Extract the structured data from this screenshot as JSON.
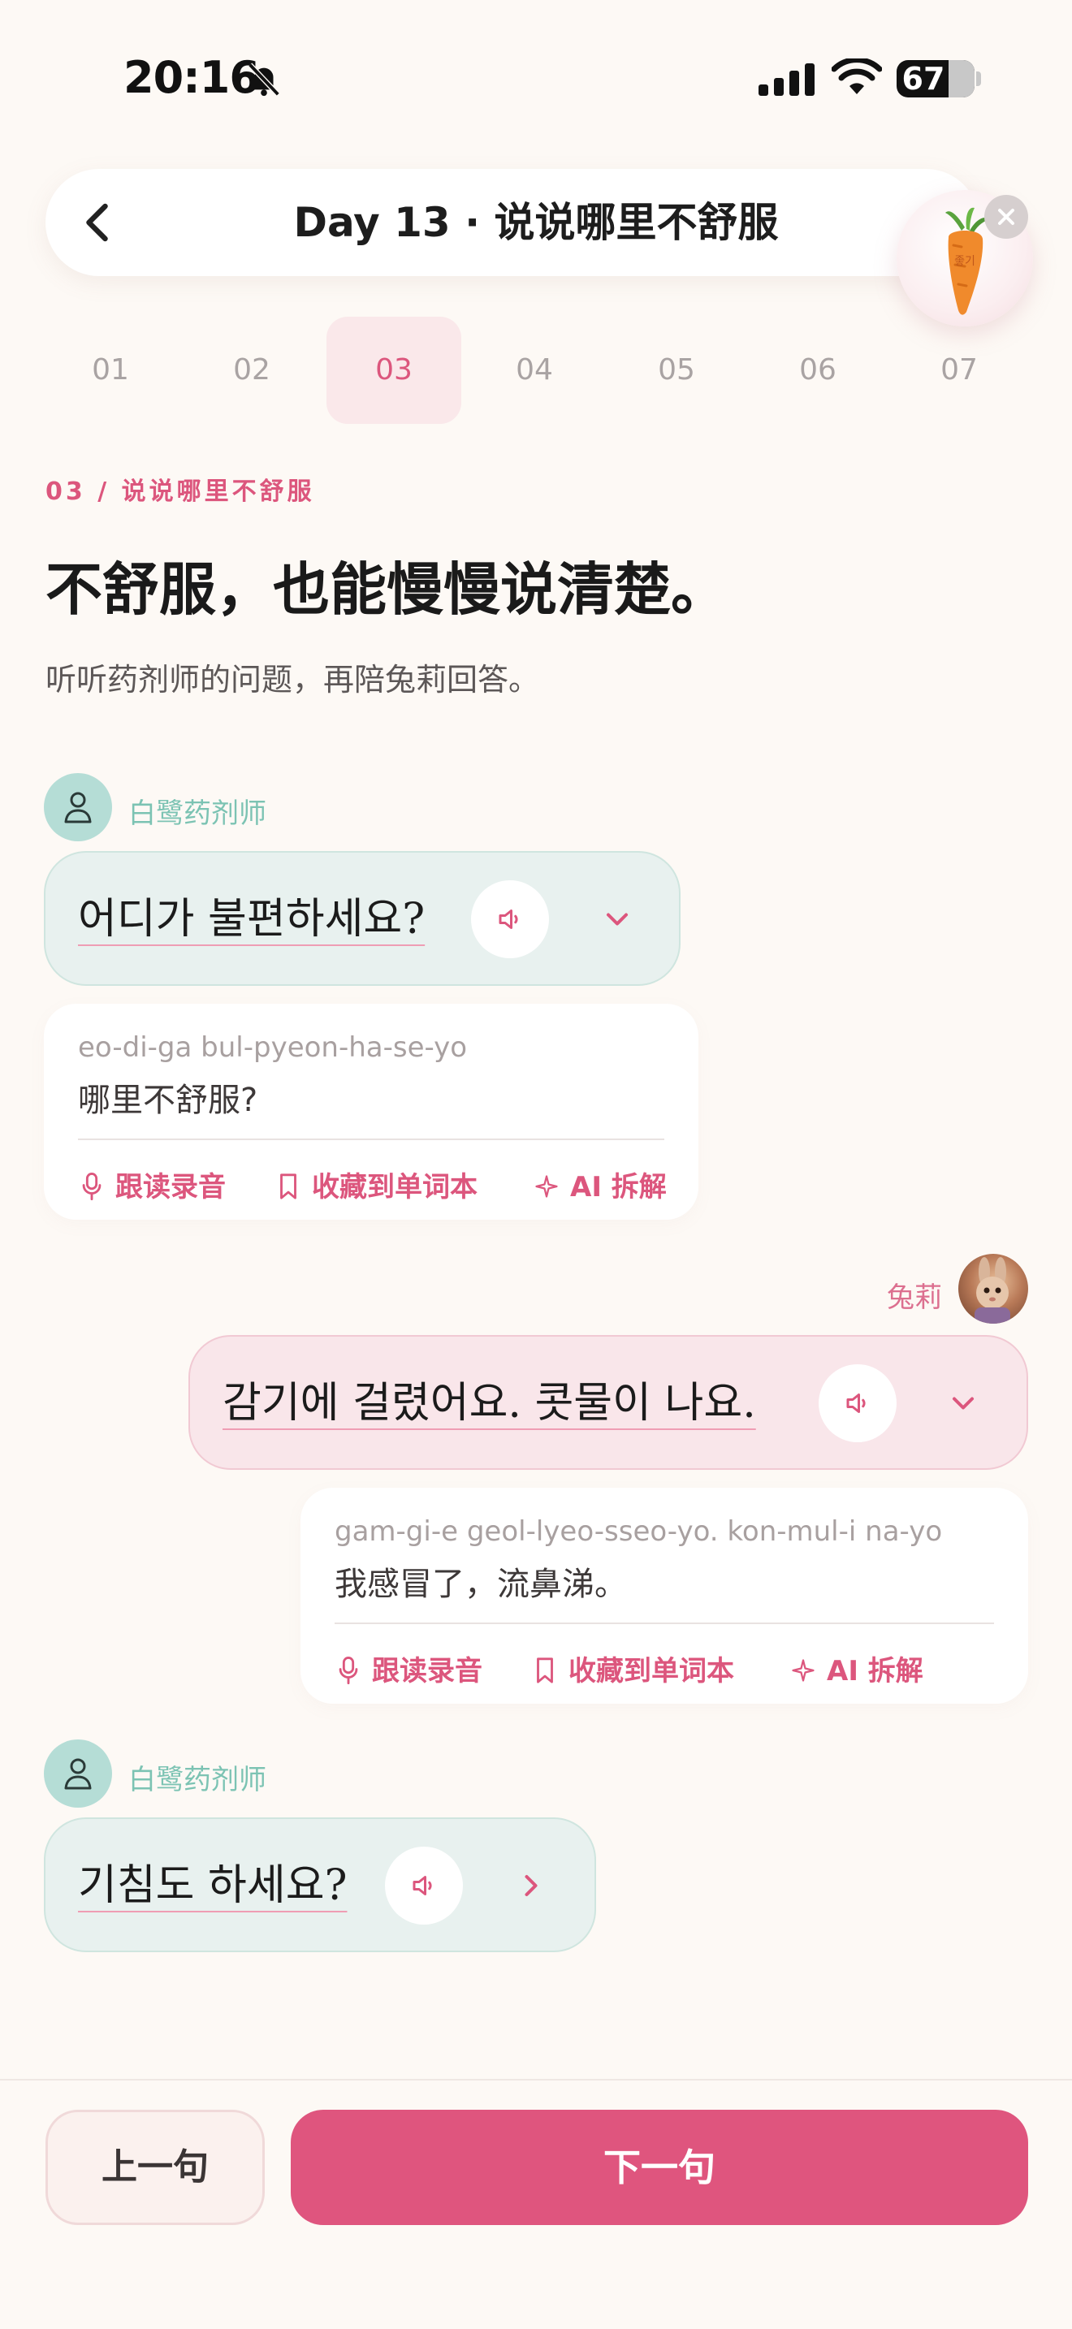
{
  "status_bar": {
    "time": "20:16",
    "battery": "67",
    "battery_level": 0.67
  },
  "header": {
    "title": "Day 13 · 说说哪里不舒服"
  },
  "tabs": [
    {
      "label": "01",
      "active": false
    },
    {
      "label": "02",
      "active": false
    },
    {
      "label": "03",
      "active": true
    },
    {
      "label": "04",
      "active": false
    },
    {
      "label": "05",
      "active": false
    },
    {
      "label": "06",
      "active": false
    },
    {
      "label": "07",
      "active": false
    }
  ],
  "lesson": {
    "crumb": "03 / 说说哪里不舒服",
    "title": "不舒服，也能慢慢说清楚。",
    "subtitle": "听听药剂师的问题，再陪兔莉回答。"
  },
  "actions": {
    "shadow": "跟读录音",
    "save": "收藏到单词本",
    "ai": "AI 拆解"
  },
  "dialogue": [
    {
      "speaker": "白鹭药剂师",
      "korean": "어디가 불편하세요?",
      "romanization": "eo-di-ga bul-pyeon-ha-se-yo",
      "translation": "哪里不舒服?"
    },
    {
      "speaker": "兔莉",
      "korean": "감기에 걸렸어요. 콧물이 나요.",
      "romanization": "gam-gi-e geol-lyeo-sseo-yo. kon-mul-i na-yo",
      "translation": "我感冒了，流鼻涕。"
    },
    {
      "speaker": "白鹭药剂师",
      "korean": "기침도 하세요?"
    }
  ],
  "mascot": {
    "carrot_text": "좋기"
  },
  "footer": {
    "prev": "上一句",
    "next": "下一句"
  },
  "colors": {
    "accent": "#df557e",
    "pharmacist": "#7cc3b3",
    "background": "#fdf9f5"
  }
}
